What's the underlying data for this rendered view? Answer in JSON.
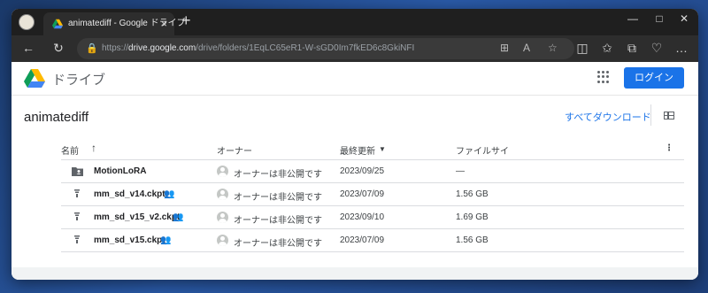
{
  "browser": {
    "tab_title": "animatediff - Google ドライブ",
    "url_prefix": "https://",
    "url_host": "drive.google.com",
    "url_path": "/drive/folders/1EqLC65eR1-W-sGD0Im7fkED6c8GkiNFI"
  },
  "drive": {
    "product_name": "ドライブ",
    "login_label": "ログイン",
    "folder_title": "animatediff",
    "download_all_label": "すべてダウンロード"
  },
  "table": {
    "headers": {
      "name": "名前",
      "owner": "オーナー",
      "modified": "最終更新",
      "size": "ファイルサイ"
    },
    "rows": [
      {
        "name": "MotionLoRA",
        "type": "folder",
        "owner": "オーナーは非公開です",
        "modified": "2023/09/25",
        "size": "—",
        "shared": false
      },
      {
        "name": "mm_sd_v14.ckpt",
        "type": "file",
        "owner": "オーナーは非公開です",
        "modified": "2023/07/09",
        "size": "1.56 GB",
        "shared": true
      },
      {
        "name": "mm_sd_v15_v2.ckpt",
        "type": "file",
        "owner": "オーナーは非公開です",
        "modified": "2023/09/10",
        "size": "1.69 GB",
        "shared": true
      },
      {
        "name": "mm_sd_v15.ckpt",
        "type": "file",
        "owner": "オーナーは非公開です",
        "modified": "2023/07/09",
        "size": "1.56 GB",
        "shared": true
      }
    ]
  },
  "colors": {
    "accent": "#1a73e8",
    "chrome_dark": "#1f1f1f",
    "text": "#3c4043"
  },
  "icons": [
    "browser-profile-icon",
    "drive-favicon",
    "tab-close-icon",
    "new-tab-icon",
    "minimize-icon",
    "maximize-icon",
    "close-window-icon",
    "back-icon",
    "refresh-icon",
    "lock-icon",
    "apps-grid-icon",
    "grid-view-icon",
    "sort-arrow-up-icon",
    "sort-desc-icon",
    "more-vert-icon",
    "folder-shared-icon",
    "file-icon",
    "shared-people-icon",
    "owner-avatar-icon"
  ]
}
